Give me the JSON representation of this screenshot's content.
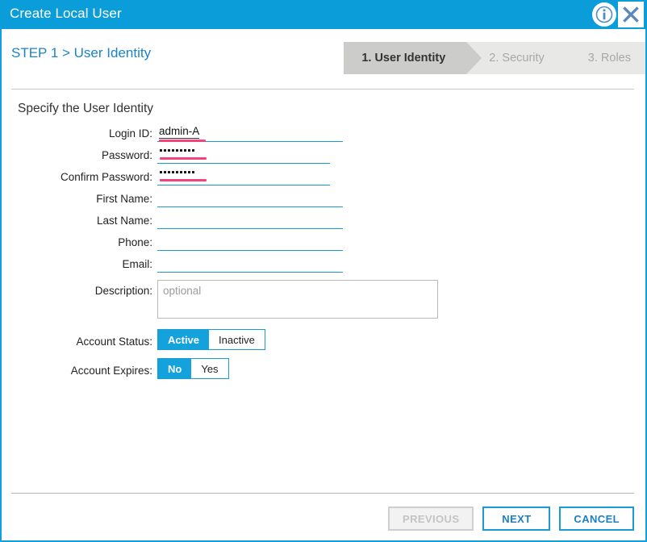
{
  "window": {
    "title": "Create Local User",
    "info_icon": "info-icon",
    "close_icon": "close-icon"
  },
  "header": {
    "step_title": "STEP 1 > User Identity",
    "steps": [
      {
        "label": "1. User Identity",
        "state": "active"
      },
      {
        "label": "2. Security",
        "state": "inactive"
      },
      {
        "label": "3. Roles",
        "state": "inactive"
      }
    ]
  },
  "form": {
    "section_title": "Specify the User Identity",
    "fields": [
      {
        "label": "Login ID:",
        "value": "admin-A",
        "placeholder": "",
        "type": "text",
        "invalid": true
      },
      {
        "label": "Password:",
        "value": "·········",
        "placeholder": "",
        "type": "password",
        "invalid": true,
        "dots": 9
      },
      {
        "label": "Confirm Password:",
        "value": "·········",
        "placeholder": "",
        "type": "password",
        "invalid": true,
        "dots": 9
      },
      {
        "label": "First Name:",
        "value": "",
        "placeholder": "",
        "type": "text",
        "invalid": false
      },
      {
        "label": "Last Name:",
        "value": "",
        "placeholder": "",
        "type": "text",
        "invalid": false
      },
      {
        "label": "Phone:",
        "value": "",
        "placeholder": "",
        "type": "text",
        "invalid": false
      },
      {
        "label": "Email:",
        "value": "",
        "placeholder": "",
        "type": "text",
        "invalid": false
      }
    ],
    "description": {
      "label": "Description:",
      "value": "",
      "placeholder": "optional"
    },
    "account_status": {
      "label": "Account Status:",
      "options": [
        "Active",
        "Inactive"
      ],
      "selected": "Active"
    },
    "account_expires": {
      "label": "Account Expires:",
      "options": [
        "No",
        "Yes"
      ],
      "selected": "No"
    }
  },
  "footer": {
    "previous_label": "PREVIOUS",
    "next_label": "NEXT",
    "cancel_label": "CANCEL"
  },
  "colors": {
    "accent_blue": "#0b9dd9",
    "input_underline": "#1b9bd4",
    "error_pink": "#f4437a",
    "step_active_bg": "#cccdca",
    "step_inactive_bg": "#e8e8e6",
    "title_link": "#1b84c6"
  }
}
